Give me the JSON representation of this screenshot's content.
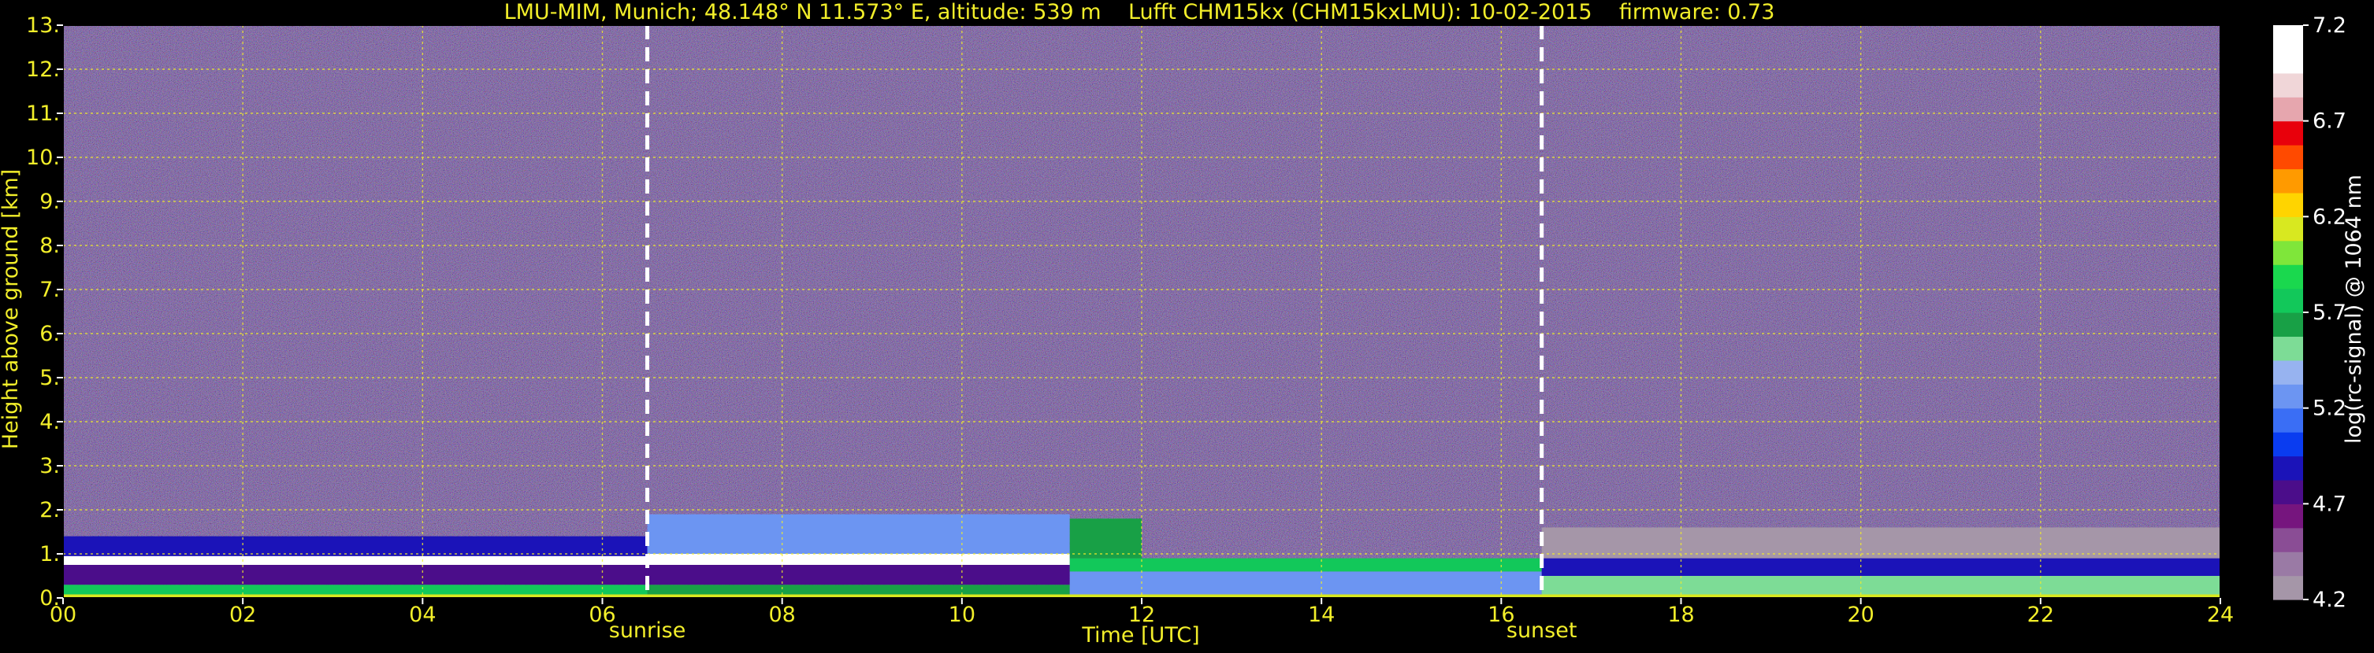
{
  "chart_data": {
    "type": "heatmap",
    "title": "LMU-MIM, Munich; 48.148° N 11.573° E, altitude: 539 m    Lufft CHM15kx (CHM15kxLMU): 10-02-2015    firmware: 0.73",
    "xlabel": "Time [UTC]",
    "ylabel": "Height above ground [km]",
    "colorbar_label": "log(rc-signal) @ 1064 nm",
    "xlim": [
      0,
      24
    ],
    "ylim": [
      0,
      13
    ],
    "x_ticks": [
      0,
      2,
      4,
      6,
      8,
      10,
      12,
      14,
      16,
      18,
      20,
      22,
      24
    ],
    "x_tick_labels": [
      "00",
      "02",
      "04",
      "06",
      "08",
      "10",
      "12",
      "14",
      "16",
      "18",
      "20",
      "22",
      "24"
    ],
    "y_ticks": [
      0,
      1,
      2,
      3,
      4,
      5,
      6,
      7,
      8,
      9,
      10,
      11,
      12,
      13
    ],
    "y_tick_labels": [
      "0.",
      "1.",
      "2.",
      "3.",
      "4.",
      "5.",
      "6.",
      "7.",
      "8.",
      "9.",
      "10.",
      "11.",
      "12.",
      "13."
    ],
    "colorbar_range": [
      4.2,
      7.2
    ],
    "colorbar_ticks": [
      4.2,
      4.7,
      5.2,
      5.7,
      6.2,
      6.7,
      7.2
    ],
    "colorbar_tick_labels": [
      "4.2",
      "4.7",
      "5.2",
      "5.7",
      "6.2",
      "6.7",
      "7.2"
    ],
    "colorbar_colors": [
      "#a596a8",
      "#9a7aa5",
      "#8a4d95",
      "#76157e",
      "#4b0d8a",
      "#1b13b8",
      "#0a3cf0",
      "#3a6ef5",
      "#6c95f2",
      "#97b3f0",
      "#7ddc96",
      "#18a046",
      "#12c85a",
      "#1ad84e",
      "#7fe63a",
      "#d8e820",
      "#ffd400",
      "#ff9a00",
      "#ff4a00",
      "#e8000b",
      "#e6a6ae",
      "#f0d6d8",
      "#ffffff",
      "#ffffff"
    ],
    "grid": true,
    "vertical_markers": [
      {
        "label": "sunrise",
        "x": 6.5
      },
      {
        "label": "sunset",
        "x": 16.45
      }
    ],
    "layers": [
      {
        "x0": 0,
        "x1": 24,
        "y0": 0,
        "y1": 0.08,
        "value": 6.1
      },
      {
        "x0": 0,
        "x1": 6.5,
        "y0": 0.08,
        "y1": 0.3,
        "value": 5.7
      },
      {
        "x0": 0,
        "x1": 6.5,
        "y0": 0.3,
        "y1": 0.75,
        "value": 4.8
      },
      {
        "x0": 0,
        "x1": 6.5,
        "y0": 0.75,
        "y1": 0.95,
        "value": 7.1
      },
      {
        "x0": 0,
        "x1": 6.5,
        "y0": 0.95,
        "y1": 1.4,
        "value": 4.9
      },
      {
        "x0": 6.5,
        "x1": 11.2,
        "y0": 0.08,
        "y1": 0.3,
        "value": 5.6
      },
      {
        "x0": 6.5,
        "x1": 11.2,
        "y0": 0.3,
        "y1": 0.75,
        "value": 4.8
      },
      {
        "x0": 6.5,
        "x1": 11.2,
        "y0": 0.75,
        "y1": 1.0,
        "value": 7.1
      },
      {
        "x0": 6.5,
        "x1": 11.2,
        "y0": 1.0,
        "y1": 1.9,
        "value": 5.3
      },
      {
        "x0": 11.2,
        "x1": 16.45,
        "y0": 0.08,
        "y1": 0.6,
        "value": 5.3
      },
      {
        "x0": 11.2,
        "x1": 16.45,
        "y0": 0.6,
        "y1": 0.9,
        "value": 5.8
      },
      {
        "x0": 11.2,
        "x1": 12.0,
        "y0": 0.9,
        "y1": 1.8,
        "value": 5.6
      },
      {
        "x0": 16.45,
        "x1": 24,
        "y0": 0.08,
        "y1": 0.5,
        "value": 5.5
      },
      {
        "x0": 16.45,
        "x1": 24,
        "y0": 0.5,
        "y1": 0.9,
        "value": 4.9
      },
      {
        "x0": 16.45,
        "x1": 24,
        "y0": 0.9,
        "y1": 1.6,
        "value": 4.3
      }
    ]
  }
}
